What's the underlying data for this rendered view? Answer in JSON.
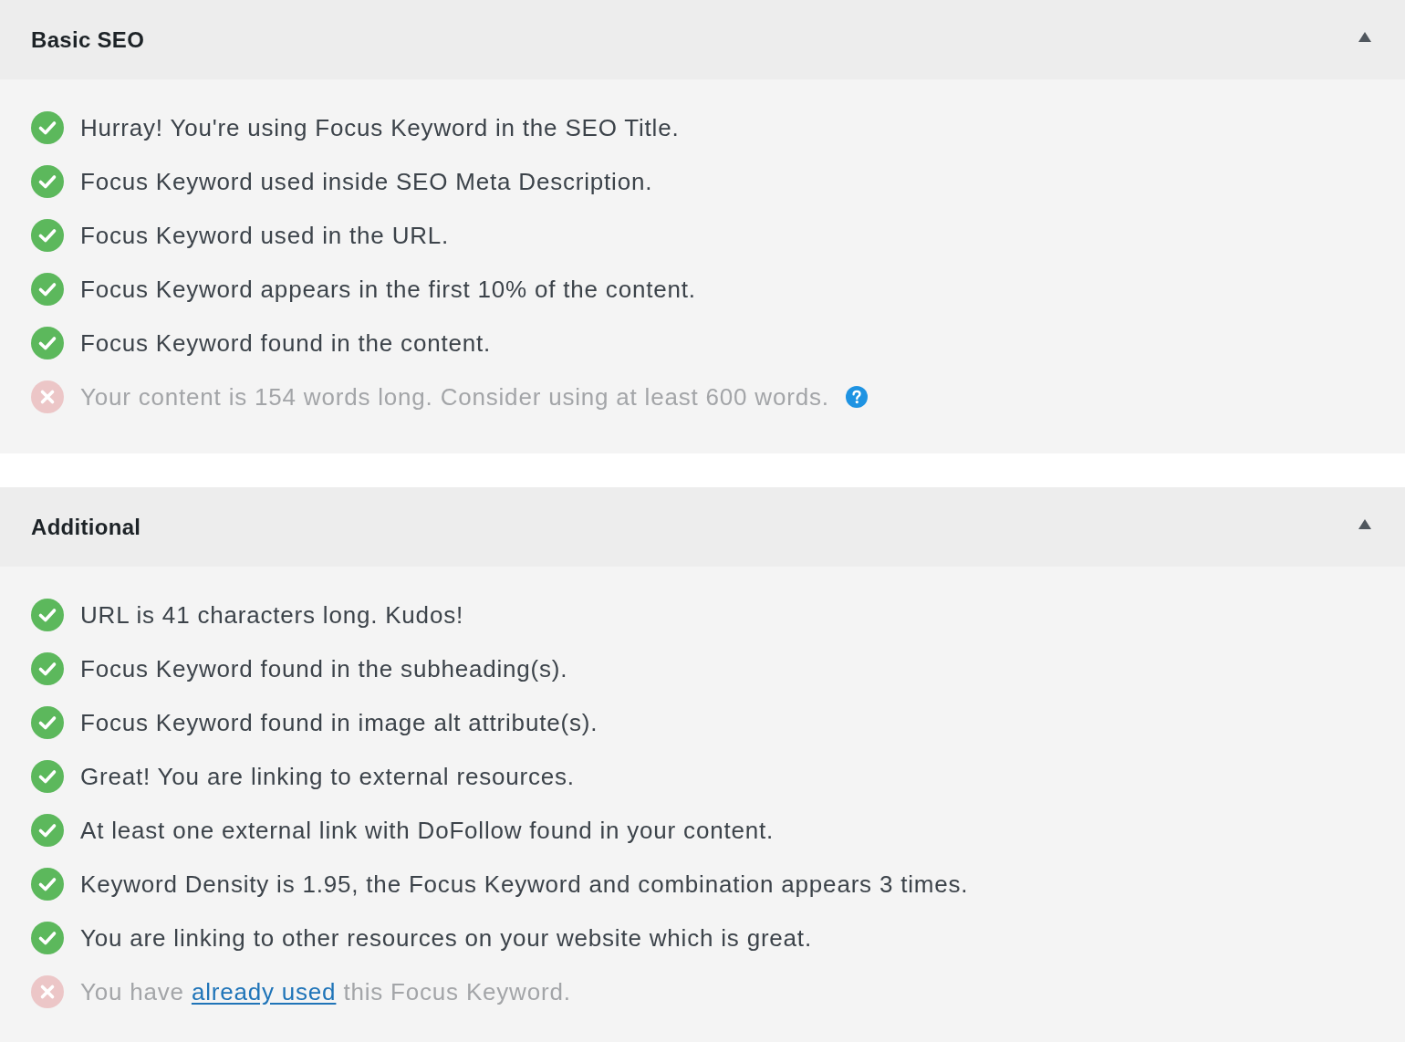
{
  "sections": [
    {
      "title": "Basic SEO",
      "expanded": true,
      "checks": [
        {
          "passed": true,
          "segments": [
            {
              "kind": "text",
              "text": "Hurray! You're using Focus Keyword in the SEO Title."
            }
          ]
        },
        {
          "passed": true,
          "segments": [
            {
              "kind": "text",
              "text": "Focus Keyword used inside SEO Meta Description."
            }
          ]
        },
        {
          "passed": true,
          "segments": [
            {
              "kind": "text",
              "text": "Focus Keyword used in the URL."
            }
          ]
        },
        {
          "passed": true,
          "segments": [
            {
              "kind": "text",
              "text": "Focus Keyword appears in the first 10% of the content."
            }
          ]
        },
        {
          "passed": true,
          "segments": [
            {
              "kind": "text",
              "text": "Focus Keyword found in the content."
            }
          ]
        },
        {
          "passed": false,
          "help": true,
          "segments": [
            {
              "kind": "text",
              "text": "Your content is 154 words long. Consider using at least 600 words."
            }
          ]
        }
      ]
    },
    {
      "title": "Additional",
      "expanded": true,
      "checks": [
        {
          "passed": true,
          "segments": [
            {
              "kind": "text",
              "text": "URL is 41 characters long. Kudos!"
            }
          ]
        },
        {
          "passed": true,
          "segments": [
            {
              "kind": "text",
              "text": "Focus Keyword found in the subheading(s)."
            }
          ]
        },
        {
          "passed": true,
          "segments": [
            {
              "kind": "text",
              "text": "Focus Keyword found in image alt attribute(s)."
            }
          ]
        },
        {
          "passed": true,
          "segments": [
            {
              "kind": "text",
              "text": "Great! You are linking to external resources."
            }
          ]
        },
        {
          "passed": true,
          "segments": [
            {
              "kind": "text",
              "text": "At least one external link with DoFollow found in your content."
            }
          ]
        },
        {
          "passed": true,
          "segments": [
            {
              "kind": "text",
              "text": "Keyword Density is 1.95, the Focus Keyword and combination appears 3 times."
            }
          ]
        },
        {
          "passed": true,
          "segments": [
            {
              "kind": "text",
              "text": "You are linking to other resources on your website which is great."
            }
          ]
        },
        {
          "passed": false,
          "segments": [
            {
              "kind": "text",
              "text": "You have "
            },
            {
              "kind": "link",
              "text": "already used"
            },
            {
              "kind": "text",
              "text": " this Focus Keyword."
            }
          ]
        }
      ]
    }
  ]
}
